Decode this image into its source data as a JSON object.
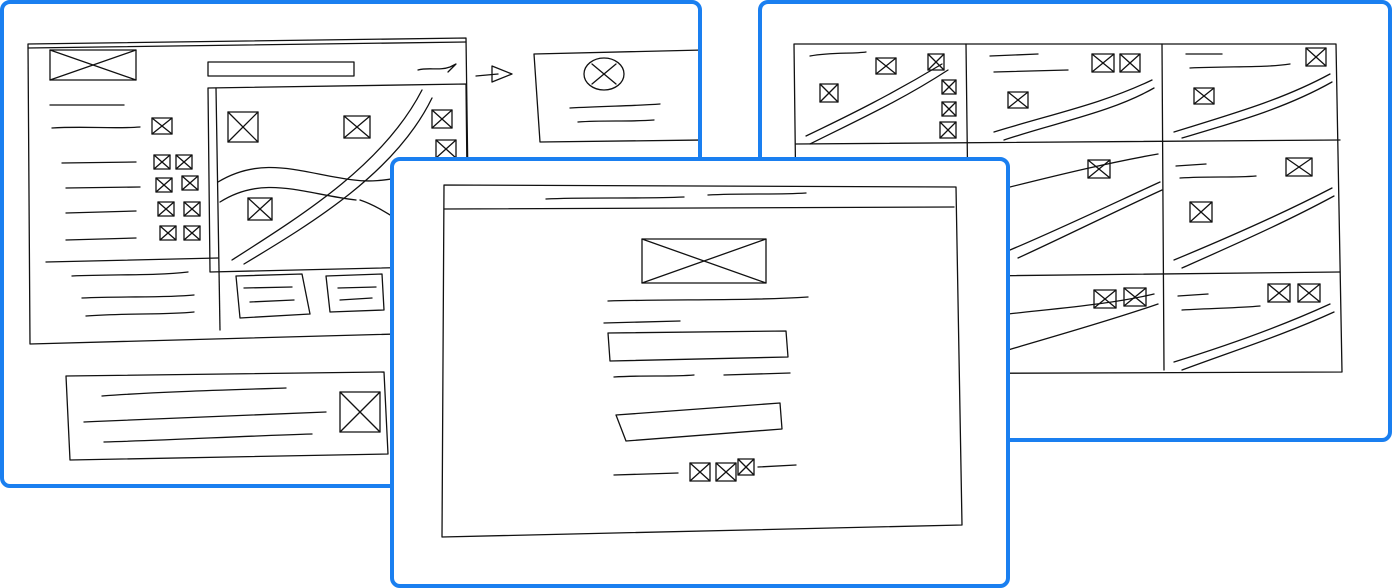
{
  "canvas": {
    "background": "#ffffff"
  },
  "cards": [
    {
      "id": "dashboard-sketch",
      "border_color": "#1a7ff0"
    },
    {
      "id": "grid-sketch",
      "border_color": "#1a7ff0"
    },
    {
      "id": "login-form-sketch",
      "border_color": "#1a7ff0"
    }
  ],
  "icons": [
    "image-placeholder-icon",
    "arrow-icon",
    "avatar-placeholder-icon",
    "line-chart-icon"
  ]
}
